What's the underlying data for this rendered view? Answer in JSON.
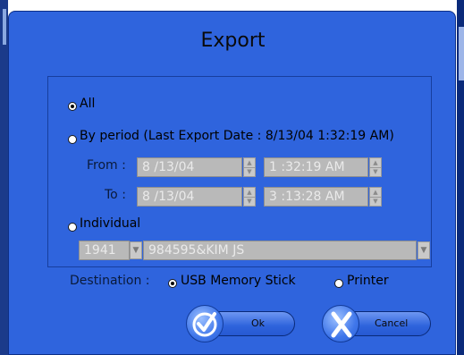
{
  "dialog": {
    "title": "Export"
  },
  "options": {
    "all_label": "All",
    "by_period_label": "By period (Last Export Date : 8/13/04 1:32:19 AM)",
    "individual_label": "Individual",
    "selected": "All"
  },
  "period": {
    "from_label": "From :",
    "to_label": "To :",
    "from_date": "8 /13/04",
    "from_time": "1 :32:19 AM",
    "to_date": "8 /13/04",
    "to_time": "3 :13:28 AM"
  },
  "individual": {
    "year": "1941",
    "person": "984595&KIM JS"
  },
  "destination": {
    "label": "Destination :",
    "usb_label": "USB Memory Stick",
    "printer_label": "Printer",
    "selected": "USB Memory Stick"
  },
  "buttons": {
    "ok_label": "Ok",
    "cancel_label": "Cancel"
  },
  "icons": {
    "ok": "checkmark-icon",
    "cancel": "x-icon",
    "spin_up": "arrow-up-icon",
    "spin_down": "arrow-down-icon",
    "dropdown": "chevron-down-icon"
  },
  "colors": {
    "dialog_bg": "#2f64dd",
    "field_disabled_bg": "#b9b9b9",
    "text": "#000000"
  }
}
